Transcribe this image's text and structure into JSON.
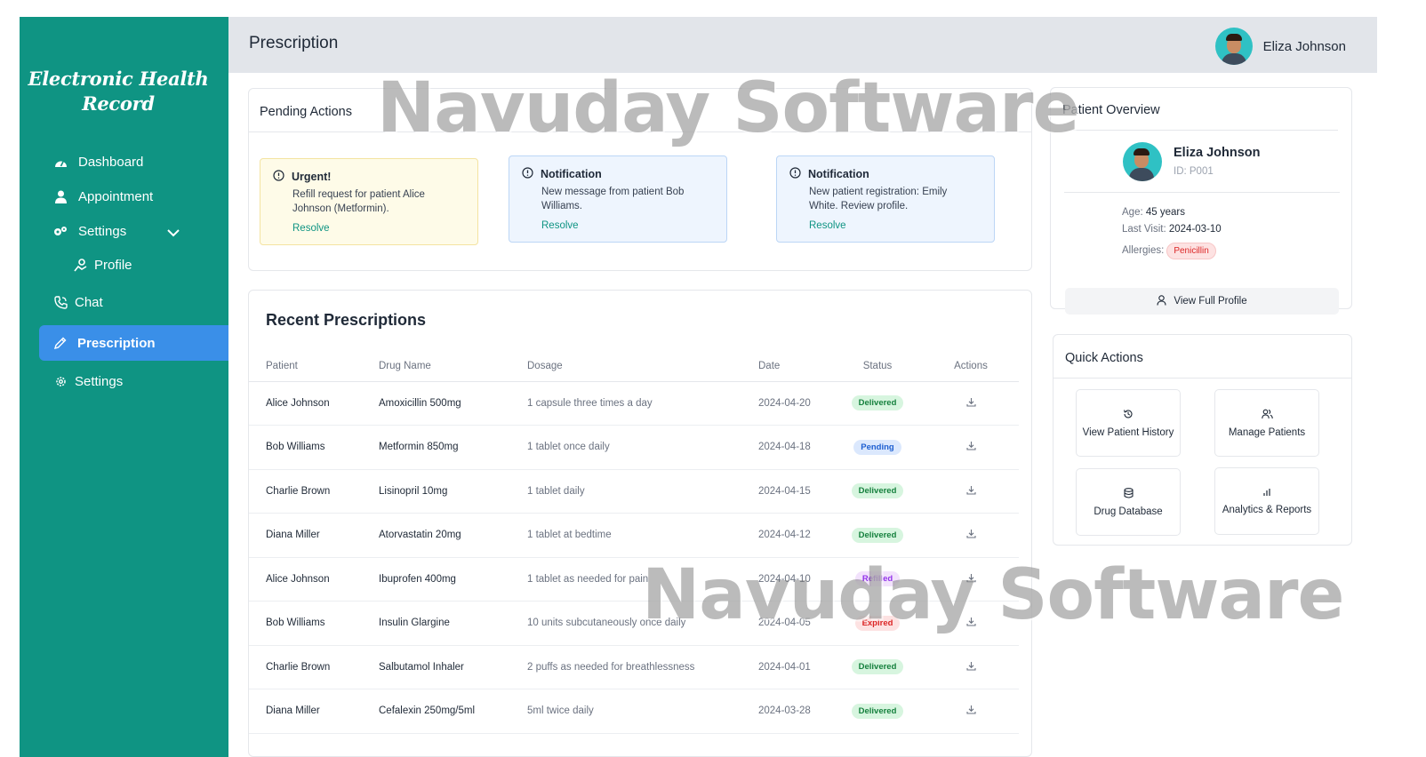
{
  "sidebar": {
    "logo": "Electronic Health Record",
    "items": [
      {
        "label": "Dashboard",
        "icon": "dashboard-icon"
      },
      {
        "label": "Appointment",
        "icon": "user-icon"
      },
      {
        "label": "Settings",
        "icon": "gears-icon"
      },
      {
        "label": "Profile",
        "icon": "profile-icon"
      },
      {
        "label": "Chat",
        "icon": "phone-icon"
      },
      {
        "label": "Prescription",
        "icon": "pen-icon"
      },
      {
        "label": "Settings",
        "icon": "gear-icon"
      }
    ],
    "active": "Prescription"
  },
  "header": {
    "title": "Prescription",
    "user_name": "Eliza Johnson"
  },
  "pending": {
    "title": "Pending Actions",
    "alerts": [
      {
        "type": "urgent",
        "title": "Urgent!",
        "body": "Refill request for patient Alice Johnson (Metformin).",
        "action": "Resolve"
      },
      {
        "type": "note",
        "title": "Notification",
        "body": "New message from patient Bob Williams.",
        "action": "Resolve"
      },
      {
        "type": "note",
        "title": "Notification",
        "body": "New patient registration: Emily White. Review profile.",
        "action": "Resolve"
      }
    ]
  },
  "prescriptions": {
    "title": "Recent Prescriptions",
    "columns": [
      "Patient",
      "Drug Name",
      "Dosage",
      "Date",
      "Status",
      "Actions"
    ],
    "rows": [
      {
        "patient": "Alice Johnson",
        "drug": "Amoxicillin 500mg",
        "dosage": "1 capsule three times a day",
        "date": "2024-04-20",
        "status": "Delivered"
      },
      {
        "patient": "Bob Williams",
        "drug": "Metformin 850mg",
        "dosage": "1 tablet once daily",
        "date": "2024-04-18",
        "status": "Pending"
      },
      {
        "patient": "Charlie Brown",
        "drug": "Lisinopril 10mg",
        "dosage": "1 tablet daily",
        "date": "2024-04-15",
        "status": "Delivered"
      },
      {
        "patient": "Diana Miller",
        "drug": "Atorvastatin 20mg",
        "dosage": "1 tablet at bedtime",
        "date": "2024-04-12",
        "status": "Delivered"
      },
      {
        "patient": "Alice Johnson",
        "drug": "Ibuprofen 400mg",
        "dosage": "1 tablet as needed for pain",
        "date": "2024-04-10",
        "status": "Refilled"
      },
      {
        "patient": "Bob Williams",
        "drug": "Insulin Glargine",
        "dosage": "10 units subcutaneously once daily",
        "date": "2024-04-05",
        "status": "Expired"
      },
      {
        "patient": "Charlie Brown",
        "drug": "Salbutamol Inhaler",
        "dosage": "2 puffs as needed for breathlessness",
        "date": "2024-04-01",
        "status": "Delivered"
      },
      {
        "patient": "Diana Miller",
        "drug": "Cefalexin 250mg/5ml",
        "dosage": "5ml twice daily",
        "date": "2024-03-28",
        "status": "Delivered"
      }
    ]
  },
  "overview": {
    "title": "Patient Overview",
    "name": "Eliza Johnson",
    "id": "ID: P001",
    "age_label": "Age:",
    "age": "45 years",
    "visit_label": "Last Visit:",
    "visit": "2024-03-10",
    "allergies_label": "Allergies:",
    "allergy": "Penicillin",
    "button": "View Full Profile"
  },
  "quick_actions": {
    "title": "Quick Actions",
    "items": [
      {
        "label": "View Patient History",
        "icon": "history-icon"
      },
      {
        "label": "Manage Patients",
        "icon": "users-icon"
      },
      {
        "label": "Drug Database",
        "icon": "database-icon"
      },
      {
        "label": "Analytics & Reports",
        "icon": "bar-chart-icon"
      }
    ]
  },
  "watermark": "Navuday Software",
  "colors": {
    "sidebar": "#0f9483",
    "active": "#3a8fe8",
    "accent": "#0f9483"
  }
}
